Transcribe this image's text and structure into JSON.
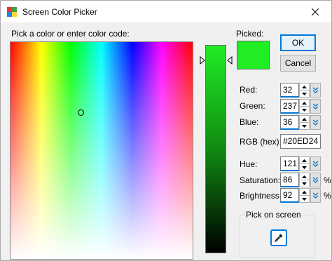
{
  "window": {
    "title": "Screen Color Picker"
  },
  "main": {
    "pick_label": "Pick a color or enter color code:",
    "picked_label": "Picked:",
    "picked_color": "#20ED24"
  },
  "buttons": {
    "ok": "OK",
    "cancel": "Cancel"
  },
  "fields": {
    "red": {
      "label": "Red:",
      "value": "32"
    },
    "green": {
      "label": "Green:",
      "value": "237"
    },
    "blue": {
      "label": "Blue:",
      "value": "36"
    },
    "rgb_hex": {
      "label": "RGB (hex):",
      "value": "#20ED24"
    },
    "hue": {
      "label": "Hue:",
      "value": "121"
    },
    "saturation": {
      "label": "Saturation:",
      "value": "86",
      "unit": "%"
    },
    "brightness": {
      "label": "Brightness:",
      "value": "92",
      "unit": "%"
    }
  },
  "pick_on_screen": {
    "title": "Pick on screen",
    "icon": "eyedropper-icon"
  },
  "colors": {
    "accent": "#0078d7"
  }
}
